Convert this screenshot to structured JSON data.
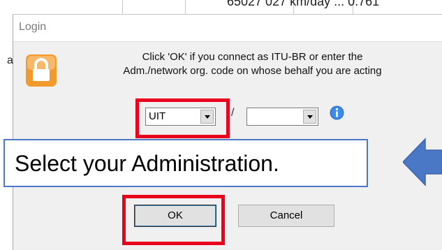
{
  "background": {
    "top_fragment": "65027 027 km/day ... 0.761",
    "left_fragment": "a"
  },
  "dialog": {
    "title": "Login",
    "message_line1": "Click 'OK' if you connect as ITU-BR or enter the",
    "message_line2": "Adm./network org. code on whose behalf you are acting",
    "admin_select_value": "UIT",
    "network_select_value": "",
    "separator": "/",
    "ok_label": "OK",
    "cancel_label": "Cancel"
  },
  "callout": {
    "text": "Select your Administration."
  },
  "colors": {
    "highlight": "#e8001c",
    "callout_border": "#4a78c6",
    "arrow": "#4a78c6",
    "lock": "#f39a2c"
  }
}
